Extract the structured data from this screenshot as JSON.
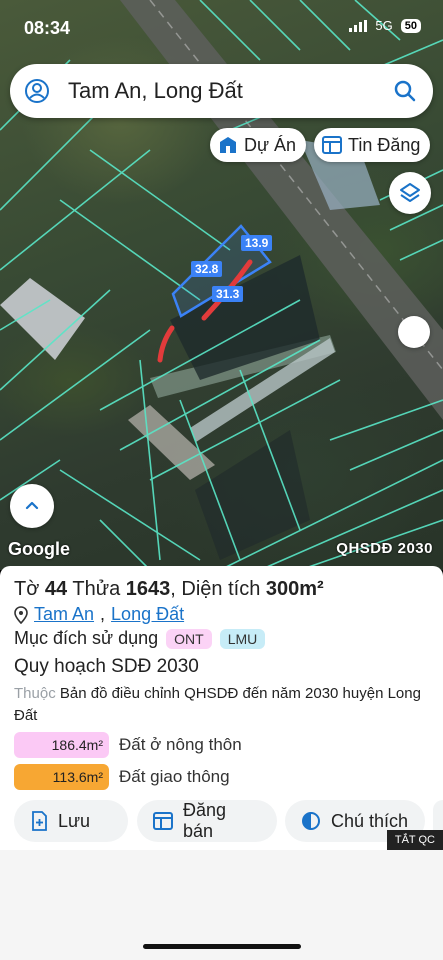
{
  "status": {
    "time": "08:34",
    "network": "5G",
    "battery": "50"
  },
  "search": {
    "query": "Tam An, Long Đất"
  },
  "chips": {
    "du_an": "Dự Án",
    "tin_dang": "Tin Đăng"
  },
  "map": {
    "dimensions": [
      "13.9",
      "32.8",
      "31.3"
    ],
    "google": "Google",
    "badge": "QHSDĐ 2030"
  },
  "lot": {
    "prefix_to": "Tờ",
    "to_number": "44",
    "prefix_thua": "Thửa",
    "thua_number": "1643",
    "area_label": ", Diện tích",
    "area_value": "300m²",
    "location_1": "Tam An",
    "location_2": "Long Đất",
    "purpose_label": "Mục đích sử dụng",
    "tags": [
      "ONT",
      "LMU"
    ],
    "plan_title": "Quy hoạch SDĐ 2030",
    "plan_prefix": "Thuộc",
    "plan_text": "Bản đồ điều chỉnh QHSDĐ đến năm 2030 huyện Long Đất",
    "areas": [
      {
        "value": "186.4m²",
        "label": "Đất ở nông thôn",
        "color": "#fbc9f5"
      },
      {
        "value": "113.6m²",
        "label": "Đất giao thông",
        "color": "#f7a733"
      }
    ]
  },
  "actions": {
    "save": "Lưu",
    "sell": "Đăng bán",
    "legend": "Chú thích"
  },
  "ad": {
    "close": "TẮT QC"
  }
}
